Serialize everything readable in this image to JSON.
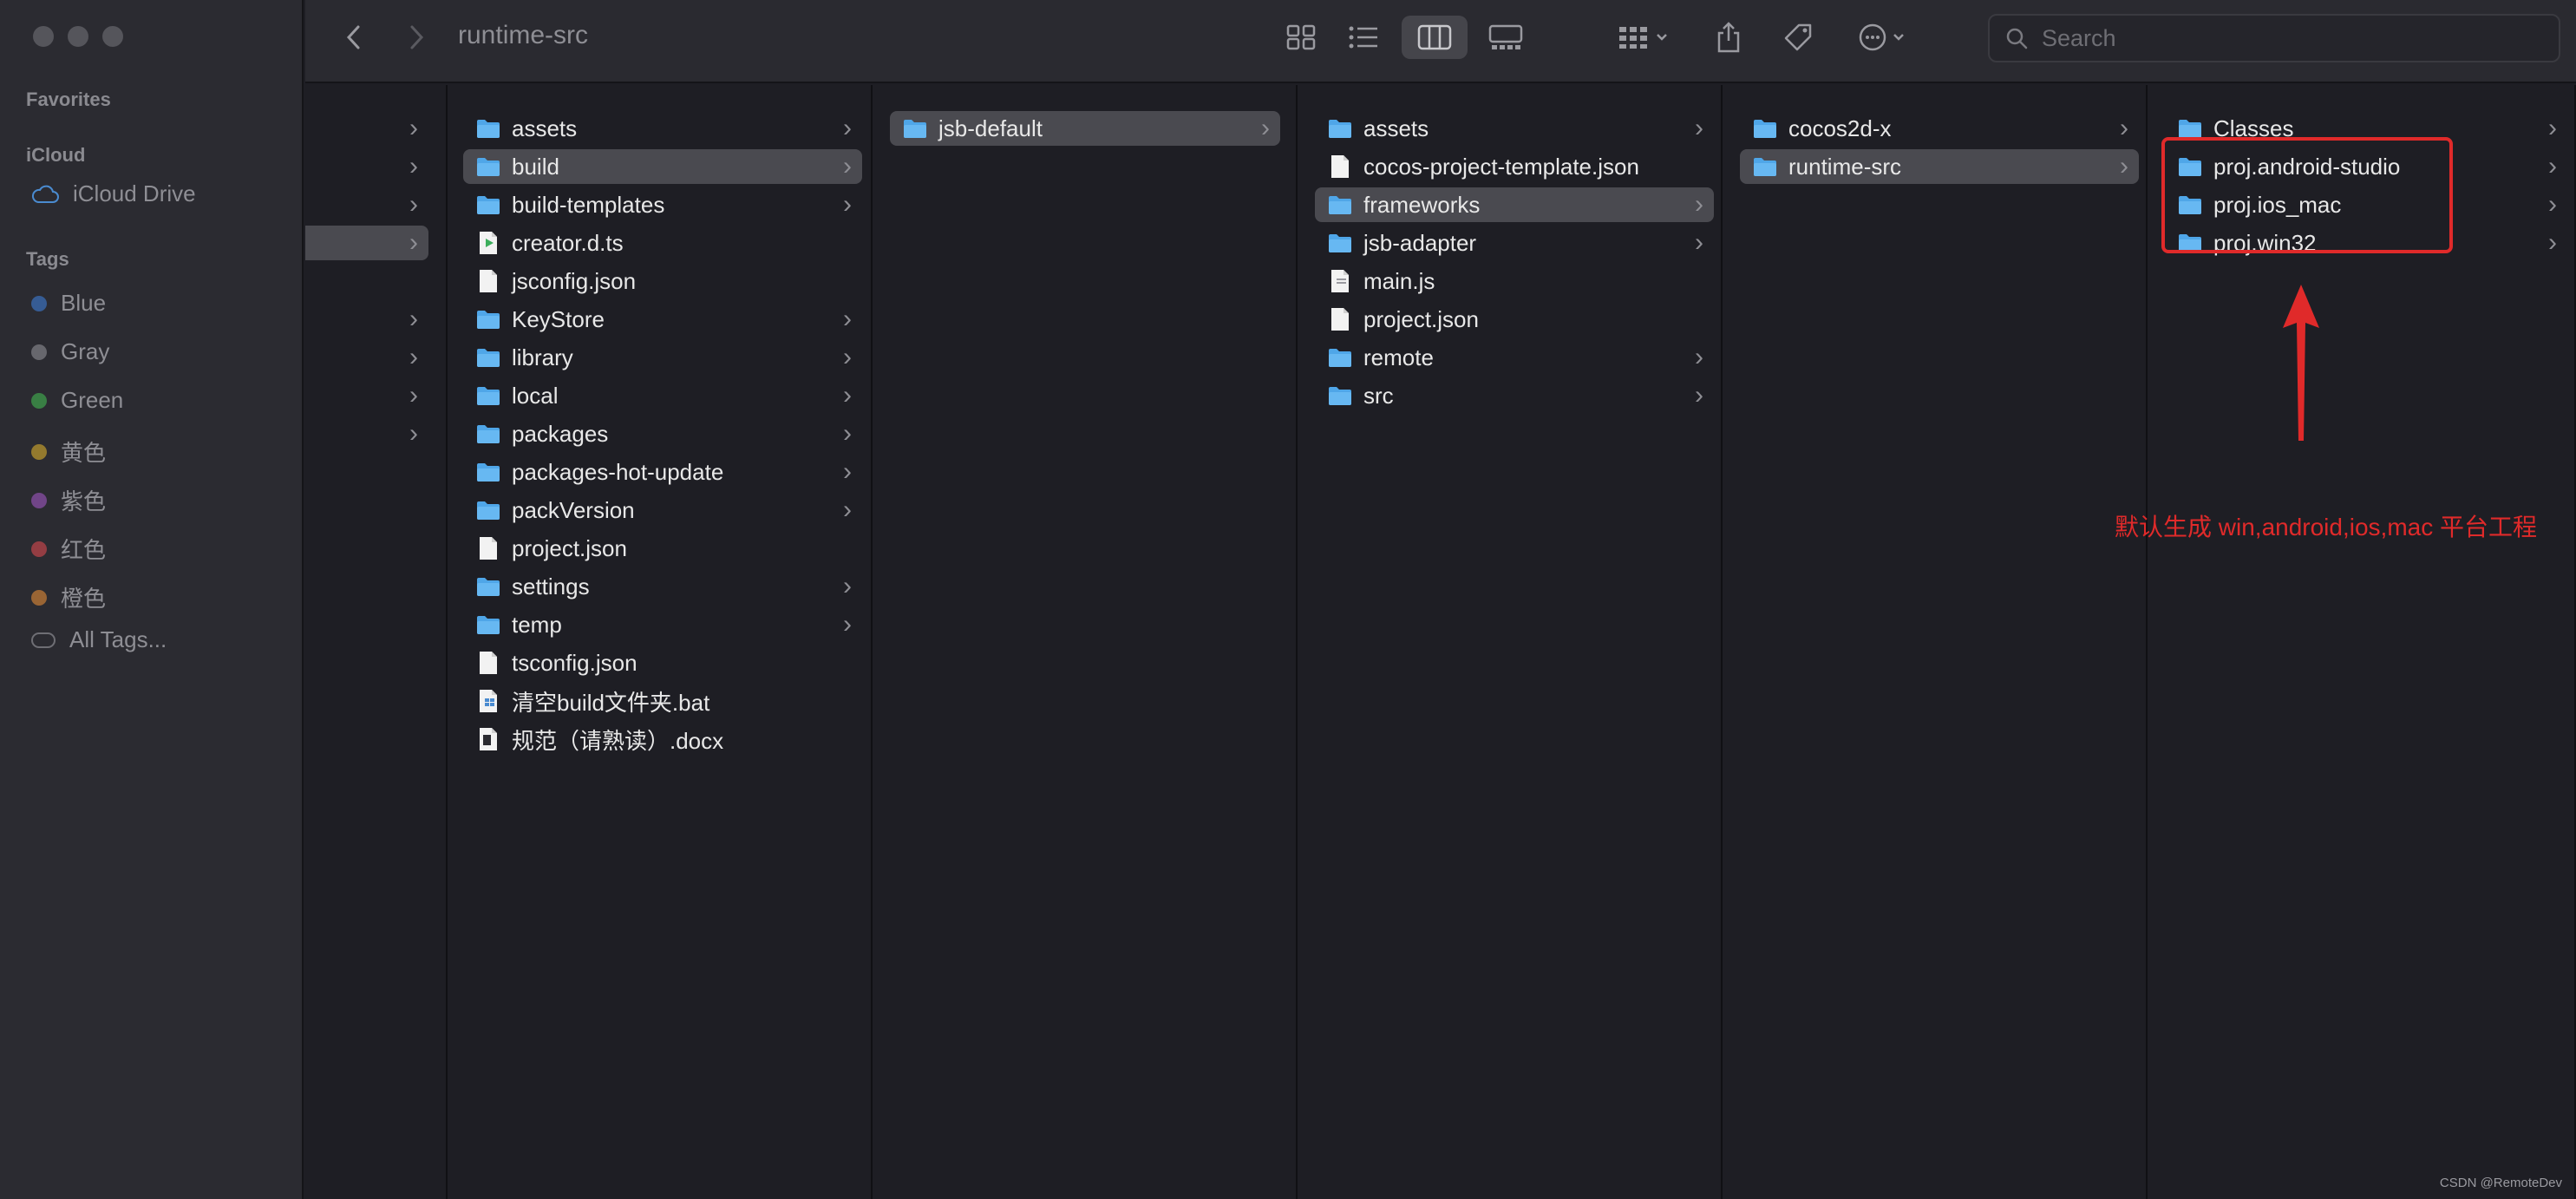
{
  "window": {
    "title": "runtime-src"
  },
  "sidebar": {
    "favorites_label": "Favorites",
    "icloud_label": "iCloud",
    "icloud_drive": "iCloud Drive",
    "tags_label": "Tags",
    "tags": [
      {
        "label": "Blue",
        "color": "#3b6db5"
      },
      {
        "label": "Gray",
        "color": "#7c7c82"
      },
      {
        "label": "Green",
        "color": "#3f9c4b"
      },
      {
        "label": "黄色",
        "color": "#b8962e"
      },
      {
        "label": "紫色",
        "color": "#8a4fa6"
      },
      {
        "label": "红色",
        "color": "#b8444a"
      },
      {
        "label": "橙色",
        "color": "#c07a35"
      }
    ],
    "all_tags": "All Tags..."
  },
  "toolbar": {
    "search_placeholder": "Search"
  },
  "columns": [
    {
      "name": "column-0",
      "items": [
        {
          "label": "",
          "type": "folder",
          "chevron": true,
          "selected": false
        },
        {
          "label": "",
          "type": "folder",
          "chevron": true,
          "selected": false
        },
        {
          "label": "",
          "type": "folder",
          "chevron": true,
          "selected": false
        },
        {
          "label": "",
          "type": "folder",
          "chevron": true,
          "selected": true
        },
        {
          "label": "",
          "type": "folder",
          "chevron": false,
          "selected": false
        },
        {
          "label": "",
          "type": "folder",
          "chevron": true,
          "selected": false
        },
        {
          "label": "",
          "type": "folder",
          "chevron": true,
          "selected": false
        },
        {
          "label": "",
          "type": "folder",
          "chevron": true,
          "selected": false
        },
        {
          "label": "",
          "type": "folder",
          "chevron": true,
          "selected": false
        }
      ]
    },
    {
      "name": "column-1",
      "items": [
        {
          "label": "assets",
          "type": "folder",
          "chevron": true,
          "selected": false
        },
        {
          "label": "build",
          "type": "folder",
          "chevron": true,
          "selected": true
        },
        {
          "label": "build-templates",
          "type": "folder",
          "chevron": true,
          "selected": false
        },
        {
          "label": "creator.d.ts",
          "type": "ts",
          "chevron": false,
          "selected": false
        },
        {
          "label": "jsconfig.json",
          "type": "file",
          "chevron": false,
          "selected": false
        },
        {
          "label": "KeyStore",
          "type": "folder",
          "chevron": true,
          "selected": false
        },
        {
          "label": "library",
          "type": "folder",
          "chevron": true,
          "selected": false
        },
        {
          "label": "local",
          "type": "folder",
          "chevron": true,
          "selected": false
        },
        {
          "label": "packages",
          "type": "folder",
          "chevron": true,
          "selected": false
        },
        {
          "label": "packages-hot-update",
          "type": "folder",
          "chevron": true,
          "selected": false
        },
        {
          "label": "packVersion",
          "type": "folder",
          "chevron": true,
          "selected": false
        },
        {
          "label": "project.json",
          "type": "file",
          "chevron": false,
          "selected": false
        },
        {
          "label": "settings",
          "type": "folder",
          "chevron": true,
          "selected": false
        },
        {
          "label": "temp",
          "type": "folder",
          "chevron": true,
          "selected": false
        },
        {
          "label": "tsconfig.json",
          "type": "file",
          "chevron": false,
          "selected": false
        },
        {
          "label": "清空build文件夹.bat",
          "type": "bat",
          "chevron": false,
          "selected": false
        },
        {
          "label": "规范（请熟读）.docx",
          "type": "docx",
          "chevron": false,
          "selected": false
        }
      ]
    },
    {
      "name": "column-2",
      "items": [
        {
          "label": "jsb-default",
          "type": "folder",
          "chevron": true,
          "selected": true
        }
      ]
    },
    {
      "name": "column-3",
      "items": [
        {
          "label": "assets",
          "type": "folder",
          "chevron": true,
          "selected": false
        },
        {
          "label": "cocos-project-template.json",
          "type": "file",
          "chevron": false,
          "selected": false
        },
        {
          "label": "frameworks",
          "type": "folder",
          "chevron": true,
          "selected": true
        },
        {
          "label": "jsb-adapter",
          "type": "folder",
          "chevron": true,
          "selected": false
        },
        {
          "label": "main.js",
          "type": "js",
          "chevron": false,
          "selected": false
        },
        {
          "label": "project.json",
          "type": "file",
          "chevron": false,
          "selected": false
        },
        {
          "label": "remote",
          "type": "folder",
          "chevron": true,
          "selected": false
        },
        {
          "label": "src",
          "type": "folder",
          "chevron": true,
          "selected": false
        }
      ]
    },
    {
      "name": "column-4",
      "items": [
        {
          "label": "cocos2d-x",
          "type": "folder",
          "chevron": true,
          "selected": false
        },
        {
          "label": "runtime-src",
          "type": "folder",
          "chevron": true,
          "selected": true
        }
      ]
    },
    {
      "name": "column-5",
      "items": [
        {
          "label": "Classes",
          "type": "folder",
          "chevron": true,
          "selected": false
        },
        {
          "label": "proj.android-studio",
          "type": "folder",
          "chevron": true,
          "selected": false
        },
        {
          "label": "proj.ios_mac",
          "type": "folder",
          "chevron": true,
          "selected": false
        },
        {
          "label": "proj.win32",
          "type": "folder",
          "chevron": true,
          "selected": false
        }
      ]
    }
  ],
  "annotation": {
    "text": "默认生成 win,android,ios,mac 平台工程",
    "color": "#e02a2a"
  },
  "watermark": "CSDN @RemoteDev"
}
